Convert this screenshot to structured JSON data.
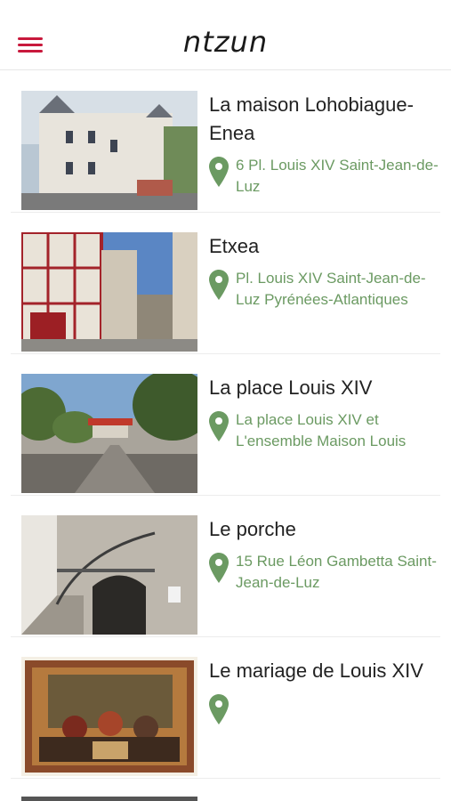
{
  "header": {
    "logo": "ntzun"
  },
  "places": [
    {
      "title": "La maison Lohobiague-Enea",
      "address": "6 Pl. Louis XIV Saint-Jean-de-Luz",
      "image": "building-facade-photo"
    },
    {
      "title": "Etxea",
      "address": "Pl. Louis XIV Saint-Jean-de-Luz Pyrénées-Atlantiques",
      "image": "street-houses-photo"
    },
    {
      "title": "La place Louis XIV",
      "address": "La place Louis XIV et L'ensemble Maison Louis XIV...",
      "image": "town-square-photo"
    },
    {
      "title": "Le porche",
      "address": "15 Rue Léon Gambetta Saint-Jean-de-Luz",
      "image": "stone-porch-photo"
    },
    {
      "title": "Le mariage de Louis XIV",
      "address": "",
      "image": "tapestry-photo"
    }
  ],
  "colors": {
    "accent": "#c8193c",
    "address": "#6b9a62",
    "pin": "#6b9a62"
  }
}
